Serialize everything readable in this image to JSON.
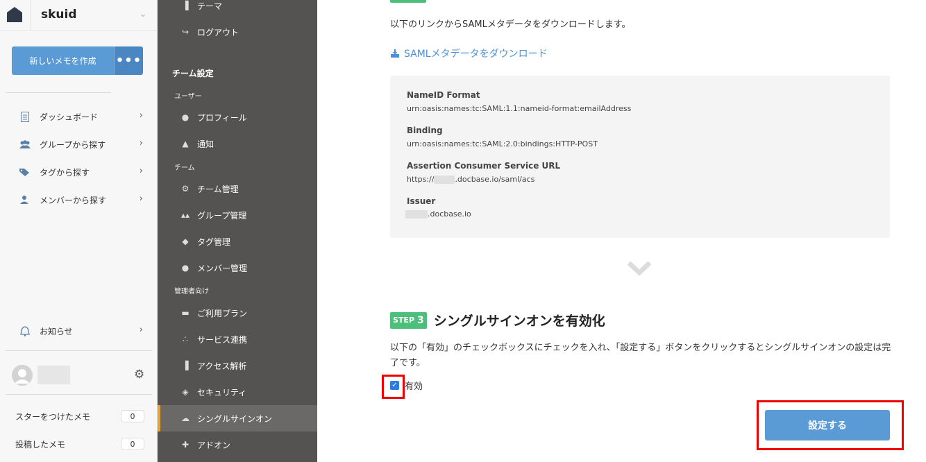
{
  "team": {
    "name": "skuid"
  },
  "sidebar": {
    "new_memo_label": "新しいメモを作成",
    "more_label": "•••",
    "nav": [
      {
        "label": "ダッシュボード",
        "icon": "document-icon"
      },
      {
        "label": "グループから探す",
        "icon": "group-icon"
      },
      {
        "label": "タグから探す",
        "icon": "tag-icon"
      },
      {
        "label": "メンバーから探す",
        "icon": "member-icon"
      }
    ],
    "notice_label": "お知らせ",
    "stats": [
      {
        "label": "スターをつけたメモ",
        "count": "0"
      },
      {
        "label": "投稿したメモ",
        "count": "0"
      }
    ]
  },
  "settings": {
    "top_items": [
      {
        "label": "テーマ",
        "icon": "theme-icon"
      },
      {
        "label": "ログアウト",
        "icon": "logout-icon"
      }
    ],
    "heading": "チーム設定",
    "user_section": "ユーザー",
    "user_items": [
      {
        "label": "プロフィール",
        "icon": "person-icon"
      },
      {
        "label": "通知",
        "icon": "bell-icon"
      }
    ],
    "team_section": "チーム",
    "team_items": [
      {
        "label": "チーム管理",
        "icon": "gear-icon"
      },
      {
        "label": "グループ管理",
        "icon": "group-icon"
      },
      {
        "label": "タグ管理",
        "icon": "tag-icon"
      },
      {
        "label": "メンバー管理",
        "icon": "member-icon"
      }
    ],
    "admin_section": "管理者向け",
    "admin_items": [
      {
        "label": "ご利用プラン",
        "icon": "card-icon"
      },
      {
        "label": "サービス連携",
        "icon": "network-icon"
      },
      {
        "label": "アクセス解析",
        "icon": "bar-chart-icon"
      },
      {
        "label": "セキュリティ",
        "icon": "shield-icon"
      },
      {
        "label": "シングルサインオン",
        "icon": "cloud-icon",
        "active": true
      },
      {
        "label": "アドオン",
        "icon": "puzzle-icon"
      }
    ]
  },
  "main": {
    "intro": "以下のリンクからSAMLメタデータをダウンロードします。",
    "download_link": "SAMLメタデータをダウンロード",
    "info": [
      {
        "label": "NameID Format",
        "value": "urn:oasis:names:tc:SAML:1.1:nameid-format:emailAddress"
      },
      {
        "label": "Binding",
        "value": "urn:oasis:names:tc:SAML:2.0:bindings:HTTP-POST"
      },
      {
        "label": "Assertion Consumer Service URL",
        "value_prefix": "https://",
        "value_suffix": ".docbase.io/saml/acs"
      },
      {
        "label": "Issuer",
        "value_suffix": ".docbase.io"
      }
    ],
    "step3": {
      "badge": "STEP",
      "number": "3",
      "title": "シングルサインオンを有効化",
      "description": "以下の「有効」のチェックボックスにチェックを入れ、「設定する」ボタンをクリックするとシングルサインオンの設定は完了です。",
      "checkbox_label": "有効",
      "checked": true,
      "submit_label": "設定する"
    }
  },
  "colors": {
    "accent": "#5b9bd5",
    "step_badge": "#4cc07a",
    "settings_bg": "#555352",
    "active_marker": "#e8a23a",
    "highlight": "#ee0000"
  }
}
